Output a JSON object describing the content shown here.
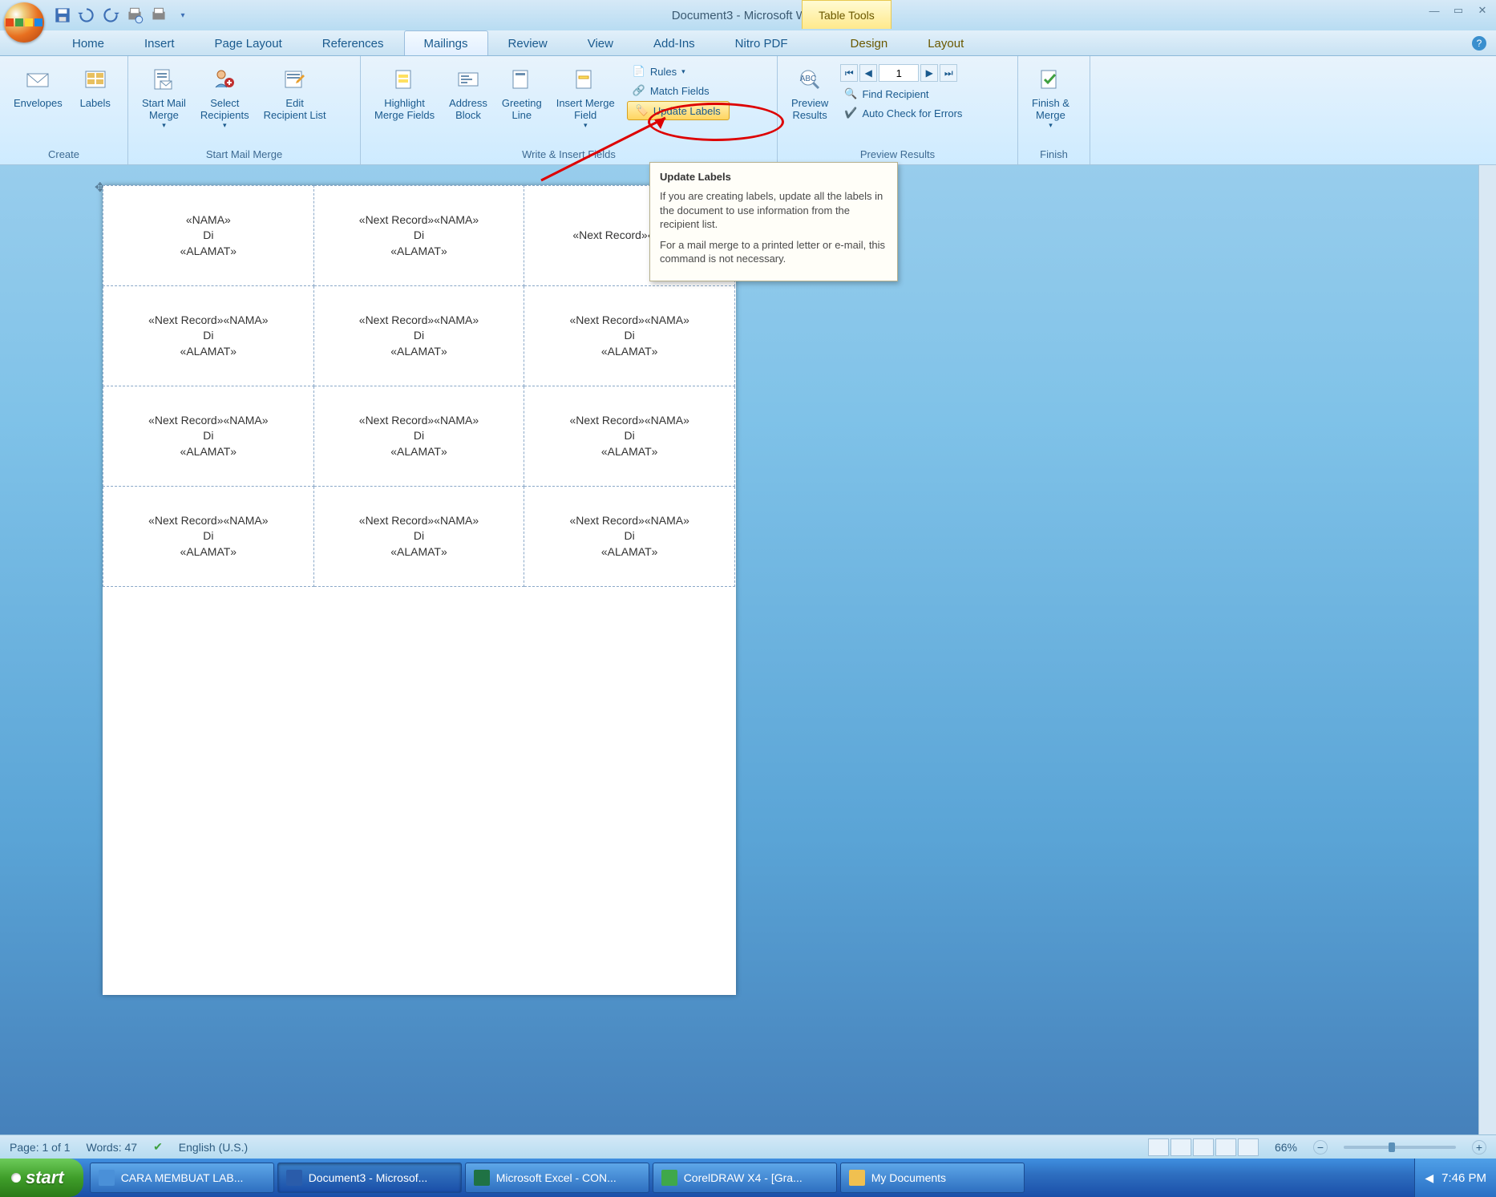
{
  "title": "Document3 - Microsoft Word",
  "context_tab": "Table Tools",
  "tabs": [
    "Home",
    "Insert",
    "Page Layout",
    "References",
    "Mailings",
    "Review",
    "View",
    "Add-Ins",
    "Nitro PDF",
    "Design",
    "Layout"
  ],
  "active_tab": "Mailings",
  "ribbon": {
    "create": {
      "label": "Create",
      "envelopes": "Envelopes",
      "labels": "Labels"
    },
    "startmm": {
      "label": "Start Mail Merge",
      "start": "Start Mail\nMerge",
      "select": "Select\nRecipients",
      "edit": "Edit\nRecipient List"
    },
    "write": {
      "label": "Write & Insert Fields",
      "highlight": "Highlight\nMerge Fields",
      "address": "Address\nBlock",
      "greeting": "Greeting\nLine",
      "insert": "Insert Merge\nField",
      "rules": "Rules",
      "match": "Match Fields",
      "update": "Update Labels"
    },
    "preview": {
      "label": "Preview Results",
      "preview": "Preview\nResults",
      "record": "1",
      "find": "Find Recipient",
      "auto": "Auto Check for Errors"
    },
    "finish": {
      "label": "Finish",
      "finish": "Finish &\nMerge"
    }
  },
  "tooltip": {
    "title": "Update Labels",
    "body1": "If you are creating labels, update all the labels in the document to use information from the recipient list.",
    "body2": "For a mail merge to a printed letter or e-mail, this command is not necessary."
  },
  "cells": {
    "first": "«NAMA»\nDi\n«ALAMAT»",
    "next": "«Next Record»«NAMA»\nDi\n«ALAMAT»",
    "partialNextNama": "«Next Record»«NAMA"
  },
  "status": {
    "page": "Page: 1 of 1",
    "words": "Words: 47",
    "lang": "English (U.S.)",
    "zoom": "66%"
  },
  "taskbar": {
    "start": "start",
    "tasks": [
      "CARA MEMBUAT LAB...",
      "Document3 - Microsof...",
      "Microsoft Excel - CON...",
      "CorelDRAW X4 - [Gra...",
      "My Documents"
    ],
    "clock": "7:46 PM"
  }
}
